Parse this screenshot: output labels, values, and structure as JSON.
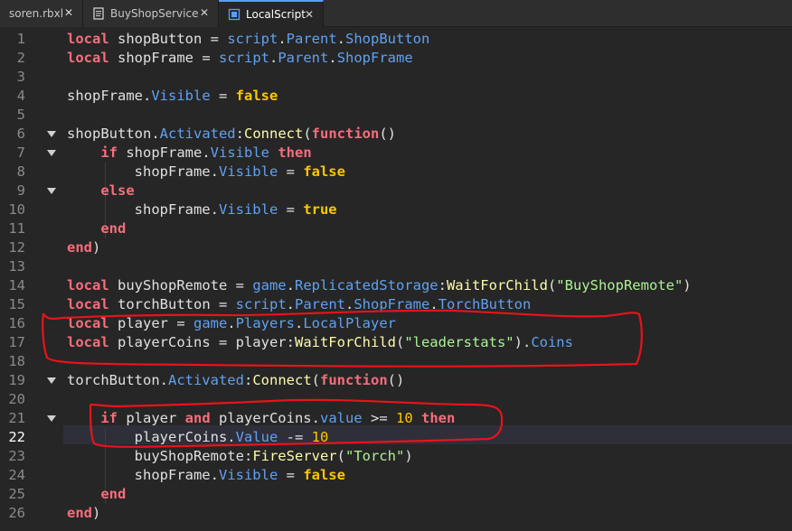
{
  "tabs": [
    {
      "label": "soren.rbxl",
      "active": false
    },
    {
      "label": "BuyShopService",
      "active": false
    },
    {
      "label": "LocalScript",
      "active": true
    }
  ],
  "close_glyph": "✕",
  "current_line": 22,
  "fold_lines": [
    6,
    7,
    9,
    19,
    21
  ],
  "lines": [
    [
      [
        "kw",
        "local"
      ],
      [
        "id",
        " shopButton = "
      ],
      [
        "prop",
        "script"
      ],
      [
        "id",
        "."
      ],
      [
        "prop",
        "Parent"
      ],
      [
        "id",
        "."
      ],
      [
        "prop",
        "ShopButton"
      ]
    ],
    [
      [
        "kw",
        "local"
      ],
      [
        "id",
        " shopFrame = "
      ],
      [
        "prop",
        "script"
      ],
      [
        "id",
        "."
      ],
      [
        "prop",
        "Parent"
      ],
      [
        "id",
        "."
      ],
      [
        "prop",
        "ShopFrame"
      ]
    ],
    [],
    [
      [
        "id",
        "shopFrame."
      ],
      [
        "prop",
        "Visible"
      ],
      [
        "id",
        " = "
      ],
      [
        "bool",
        "false"
      ]
    ],
    [],
    [
      [
        "id",
        "shopButton."
      ],
      [
        "prop",
        "Activated"
      ],
      [
        "id",
        ":"
      ],
      [
        "fn",
        "Connect"
      ],
      [
        "id",
        "("
      ],
      [
        "kw",
        "function"
      ],
      [
        "id",
        "()"
      ]
    ],
    [
      [
        "id",
        "    "
      ],
      [
        "kw",
        "if"
      ],
      [
        "id",
        " shopFrame."
      ],
      [
        "prop",
        "Visible"
      ],
      [
        "id",
        " "
      ],
      [
        "kw",
        "then"
      ]
    ],
    [
      [
        "id",
        "        shopFrame."
      ],
      [
        "prop",
        "Visible"
      ],
      [
        "id",
        " = "
      ],
      [
        "bool",
        "false"
      ]
    ],
    [
      [
        "id",
        "    "
      ],
      [
        "kw",
        "else"
      ]
    ],
    [
      [
        "id",
        "        shopFrame."
      ],
      [
        "prop",
        "Visible"
      ],
      [
        "id",
        " = "
      ],
      [
        "bool",
        "true"
      ]
    ],
    [
      [
        "id",
        "    "
      ],
      [
        "kw",
        "end"
      ]
    ],
    [
      [
        "kw",
        "end"
      ],
      [
        "id",
        ")"
      ]
    ],
    [],
    [
      [
        "kw",
        "local"
      ],
      [
        "id",
        " buyShopRemote = "
      ],
      [
        "prop",
        "game"
      ],
      [
        "id",
        "."
      ],
      [
        "prop",
        "ReplicatedStorage"
      ],
      [
        "id",
        ":"
      ],
      [
        "fn",
        "WaitForChild"
      ],
      [
        "id",
        "("
      ],
      [
        "str",
        "\"BuyShopRemote\""
      ],
      [
        "id",
        ")"
      ]
    ],
    [
      [
        "kw",
        "local"
      ],
      [
        "id",
        " torchButton = "
      ],
      [
        "prop",
        "script"
      ],
      [
        "id",
        "."
      ],
      [
        "prop",
        "Parent"
      ],
      [
        "id",
        "."
      ],
      [
        "prop",
        "ShopFrame"
      ],
      [
        "id",
        "."
      ],
      [
        "prop",
        "TorchButton"
      ]
    ],
    [
      [
        "kw",
        "local"
      ],
      [
        "id",
        " player = "
      ],
      [
        "prop",
        "game"
      ],
      [
        "id",
        "."
      ],
      [
        "prop",
        "Players"
      ],
      [
        "id",
        "."
      ],
      [
        "prop",
        "LocalPlayer"
      ]
    ],
    [
      [
        "kw",
        "local"
      ],
      [
        "id",
        " playerCoins = player:"
      ],
      [
        "fn",
        "WaitForChild"
      ],
      [
        "id",
        "("
      ],
      [
        "str",
        "\"leaderstats\""
      ],
      [
        "id",
        ")."
      ],
      [
        "prop",
        "Coins"
      ]
    ],
    [],
    [
      [
        "id",
        "torchButton."
      ],
      [
        "prop",
        "Activated"
      ],
      [
        "id",
        ":"
      ],
      [
        "fn",
        "Connect"
      ],
      [
        "id",
        "("
      ],
      [
        "kw",
        "function"
      ],
      [
        "id",
        "()"
      ]
    ],
    [],
    [
      [
        "id",
        "    "
      ],
      [
        "kw",
        "if"
      ],
      [
        "id",
        " player "
      ],
      [
        "kw",
        "and"
      ],
      [
        "id",
        " playerCoins."
      ],
      [
        "prop",
        "value"
      ],
      [
        "id",
        " >= "
      ],
      [
        "num",
        "10"
      ],
      [
        "id",
        " "
      ],
      [
        "kw",
        "then"
      ]
    ],
    [
      [
        "id",
        "        playerCoins."
      ],
      [
        "prop",
        "Value"
      ],
      [
        "id",
        " -= "
      ],
      [
        "num",
        "10"
      ]
    ],
    [
      [
        "id",
        "        buyShopRemote:"
      ],
      [
        "fn",
        "FireServer"
      ],
      [
        "id",
        "("
      ],
      [
        "str",
        "\"Torch\""
      ],
      [
        "id",
        ")"
      ]
    ],
    [
      [
        "id",
        "        shopFrame."
      ],
      [
        "prop",
        "Visible"
      ],
      [
        "id",
        " = "
      ],
      [
        "bool",
        "false"
      ]
    ],
    [
      [
        "id",
        "    "
      ],
      [
        "kw",
        "end"
      ]
    ],
    [
      [
        "kw",
        "end"
      ],
      [
        "id",
        ")"
      ]
    ]
  ],
  "annotation_color": "#e8131b"
}
